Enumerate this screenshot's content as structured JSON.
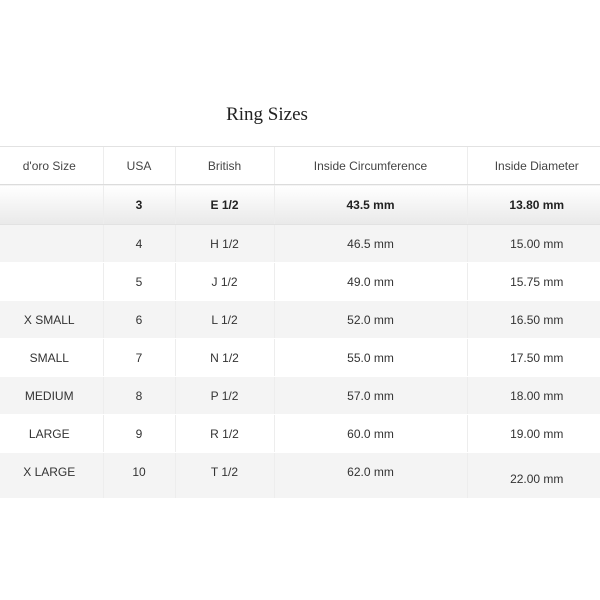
{
  "title": "Ring Sizes",
  "table": {
    "headers": [
      "d'oro Size",
      "USA",
      "British",
      "Inside Circumference",
      "Inside Diameter"
    ],
    "rows": [
      [
        "",
        "3",
        "E 1/2",
        "43.5 mm",
        "13.80 mm"
      ],
      [
        "",
        "4",
        "H 1/2",
        "46.5 mm",
        "15.00 mm"
      ],
      [
        "",
        "5",
        "J 1/2",
        "49.0 mm",
        "15.75 mm"
      ],
      [
        "X SMALL",
        "6",
        "L 1/2",
        "52.0 mm",
        "16.50 mm"
      ],
      [
        "SMALL",
        "7",
        "N 1/2",
        "55.0 mm",
        "17.50 mm"
      ],
      [
        "MEDIUM",
        "8",
        "P 1/2",
        "57.0 mm",
        "18.00 mm"
      ],
      [
        "LARGE",
        "9",
        "R 1/2",
        "60.0 mm",
        "19.00 mm"
      ],
      [
        "X LARGE",
        "10",
        "T 1/2",
        "62.0 mm",
        "22.00 mm"
      ]
    ]
  }
}
